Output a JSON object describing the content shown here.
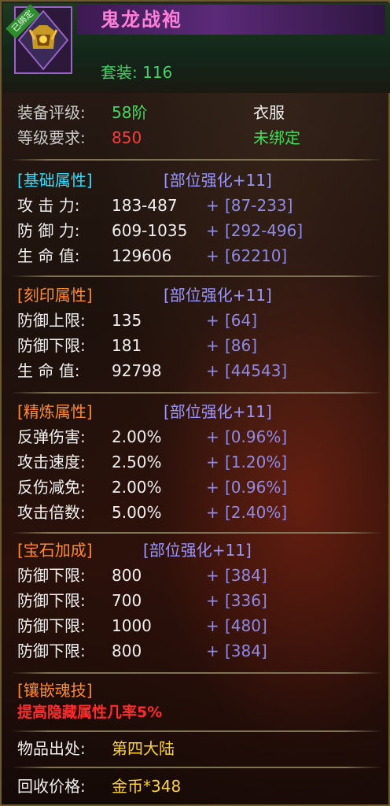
{
  "header": {
    "bound_tag": "已绑定",
    "item_name": "鬼龙战袍",
    "set_label": "套装: 116"
  },
  "info": {
    "grade_label": "装备评级:",
    "grade_value": "58阶",
    "type_value": "衣服",
    "level_label": "等级要求:",
    "level_value": "850",
    "bind_value": "未绑定"
  },
  "sections": {
    "base": {
      "title": "[基础属性]",
      "enhance": "[部位强化+11]",
      "rows": [
        {
          "label": "攻 击 力:",
          "value": "183-487",
          "plus": "+",
          "bonus": "[87-233]"
        },
        {
          "label": "防 御 力:",
          "value": "609-1035",
          "plus": "+",
          "bonus": "[292-496]"
        },
        {
          "label": "生 命 值:",
          "value": "129606",
          "plus": "+",
          "bonus": "[62210]"
        }
      ]
    },
    "engrave": {
      "title": "[刻印属性]",
      "enhance": "[部位强化+11]",
      "rows": [
        {
          "label": "防御上限:",
          "value": "135",
          "plus": "+",
          "bonus": "[64]"
        },
        {
          "label": "防御下限:",
          "value": "181",
          "plus": "+",
          "bonus": "[86]"
        },
        {
          "label": "生 命 值:",
          "value": "92798",
          "plus": "+",
          "bonus": "[44543]"
        }
      ]
    },
    "refine": {
      "title": "[精炼属性]",
      "enhance": "[部位强化+11]",
      "rows": [
        {
          "label": "反弹伤害:",
          "value": "2.00%",
          "plus": "+",
          "bonus": "[0.96%]"
        },
        {
          "label": "攻击速度:",
          "value": "2.50%",
          "plus": "+",
          "bonus": "[1.20%]"
        },
        {
          "label": "反伤减免:",
          "value": "2.00%",
          "plus": "+",
          "bonus": "[0.96%]"
        },
        {
          "label": "攻击倍数:",
          "value": "5.00%",
          "plus": "+",
          "bonus": "[2.40%]"
        }
      ]
    },
    "gem": {
      "title": "[宝石加成]",
      "enhance": "[部位强化+11]",
      "rows": [
        {
          "label": "防御下限:",
          "value": "800",
          "plus": "+",
          "bonus": "[384]"
        },
        {
          "label": "防御下限:",
          "value": "700",
          "plus": "+",
          "bonus": "[336]"
        },
        {
          "label": "防御下限:",
          "value": "1000",
          "plus": "+",
          "bonus": "[480]"
        },
        {
          "label": "防御下限:",
          "value": "800",
          "plus": "+",
          "bonus": "[384]"
        }
      ]
    }
  },
  "inlay": {
    "title": "[镶嵌魂技]",
    "text": "提高隐藏属性几率5%"
  },
  "footer": {
    "origin_label": "物品出处:",
    "origin_value": "第四大陆",
    "recycle_label": "回收价格:",
    "recycle_value": "金币*348"
  },
  "colors": {
    "title": "#ff7fd8",
    "green": "#3fdc5a",
    "red": "#ff3b3b",
    "cyan": "#2fe0ff",
    "orange": "#ff8a2a",
    "blue": "#9a96ff",
    "yellow": "#ffd42a"
  }
}
